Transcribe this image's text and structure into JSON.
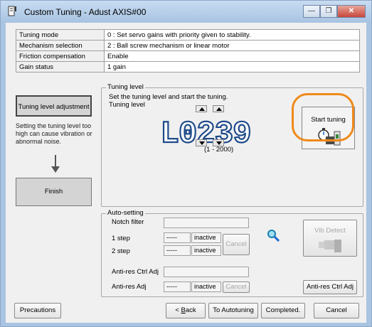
{
  "window": {
    "title": "Custom Tuning - Adust AXIS#00",
    "buttons": [
      "minimize",
      "maximize",
      "close"
    ]
  },
  "params": [
    {
      "label": "Tuning mode",
      "value": "0 : Set servo gains with priority given to stability."
    },
    {
      "label": "Mechanism selection",
      "value": "2 : Ball screw mechanism or linear motor"
    },
    {
      "label": "Friction compensation",
      "value": "Enable"
    },
    {
      "label": "Gain status",
      "value": "1 gain"
    }
  ],
  "flow": {
    "step1": "Tuning level adjustment",
    "note": "Setting the tuning level too high can cause vibration or abnormal noise.",
    "step2": "Finish"
  },
  "tuning": {
    "group_title": "Tuning level",
    "instruction": "Set the tuning level and start the tuning.",
    "level_label": "Tuning level",
    "display": "L0239",
    "range": "(1 - 2000)",
    "start_button": "Start tuning"
  },
  "auto": {
    "group_title": "Auto-setting",
    "notch_label": "Notch filter",
    "step1_label": "1 step",
    "step2_label": "2 step",
    "step1_value": "-----",
    "step2_value": "-----",
    "step1_status": "inactive",
    "step2_status": "inactive",
    "cancel": "Cancel",
    "vib_detect": "Vib Detect",
    "antires_ctrl_label": "Anti-res Ctrl Adj",
    "antires_label": "Anti-res Adj",
    "antires_value": "-----",
    "antires_status": "inactive",
    "antires_cancel": "Cancel",
    "antires_button": "Anti-res Ctrl Adj"
  },
  "footer": {
    "precautions": "Precautions",
    "back_prefix": "< ",
    "back_key": "B",
    "back_suffix": "ack",
    "to_autotuning": "To Autotuning",
    "completed": "Completed.",
    "cancel": "Cancel"
  },
  "colors": {
    "highlight": "#f0891a",
    "lcd": "#1f4a8a",
    "window_frame": "#a9c4e2"
  }
}
